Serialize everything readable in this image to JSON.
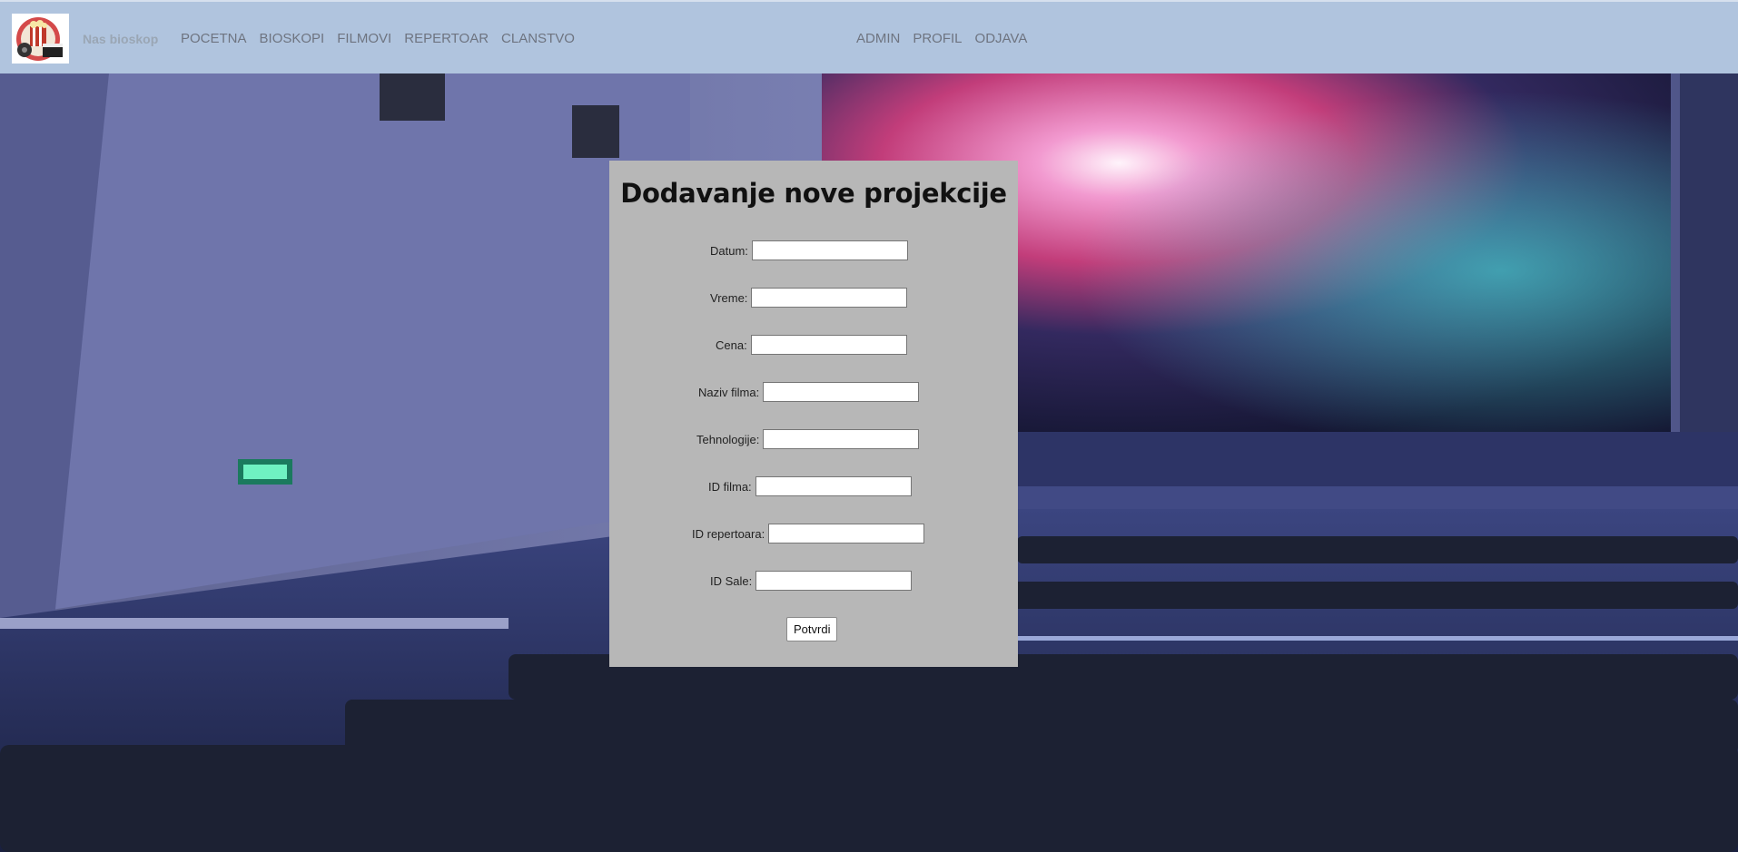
{
  "nav": {
    "brand": "Nas bioskop",
    "left_links": [
      "POCETNA",
      "BIOSKOPI",
      "FILMOVI",
      "REPERTOAR",
      "CLANSTVO"
    ],
    "right_links": [
      "ADMIN",
      "PROFIL",
      "ODJAVA"
    ]
  },
  "form": {
    "title": "Dodavanje nove projekcije",
    "fields": [
      {
        "label": "Datum:",
        "value": ""
      },
      {
        "label": "Vreme:",
        "value": ""
      },
      {
        "label": "Cena:",
        "value": ""
      },
      {
        "label": "Naziv filma:",
        "value": ""
      },
      {
        "label": "Tehnologije:",
        "value": ""
      },
      {
        "label": "ID filma:",
        "value": ""
      },
      {
        "label": "ID repertoara:",
        "value": ""
      },
      {
        "label": "ID Sale:",
        "value": ""
      }
    ],
    "submit_label": "Potvrdi"
  },
  "colors": {
    "navbar": "#b0c4de",
    "panel": "#b7b7b7"
  }
}
